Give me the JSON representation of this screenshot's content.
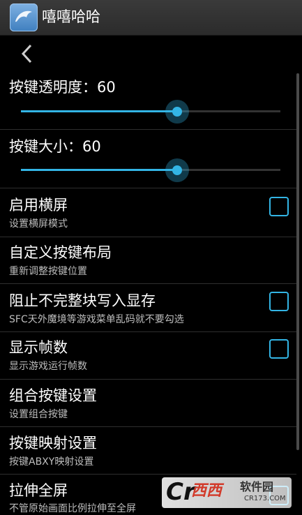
{
  "app": {
    "title": "嘻嘻哈哈"
  },
  "settings": {
    "opacity": {
      "label": "按键透明度：60",
      "value": 60,
      "max": 100
    },
    "size": {
      "label": "按键大小：60",
      "value": 60,
      "max": 100
    },
    "landscape": {
      "title": "启用横屏",
      "subtitle": "设置横屏模式",
      "checked": false
    },
    "custom_layout": {
      "title": "自定义按键布局",
      "subtitle": "重新调整按键位置"
    },
    "block_incomplete": {
      "title": "阻止不完整块写入显存",
      "subtitle": "SFC天外魔境等游戏菜单乱码就不要勾选",
      "checked": false
    },
    "show_fps": {
      "title": "显示帧数",
      "subtitle": "显示游戏运行帧数",
      "checked": false
    },
    "combo_keys": {
      "title": "组合按键设置",
      "subtitle": "设置组合按键"
    },
    "key_mapping": {
      "title": "按键映射设置",
      "subtitle": "按键ABXY映射设置"
    },
    "stretch": {
      "title": "拉伸全屏",
      "subtitle": "不管原始画面比例拉伸至全屏",
      "checked": false
    }
  },
  "watermark": {
    "logo": "Cr",
    "logo_mark": "西西",
    "name": "软件园",
    "domain": "CR173.COM"
  },
  "colors": {
    "accent": "#33b5e5",
    "background": "#000000",
    "titlebar": "#2b2b2b"
  }
}
